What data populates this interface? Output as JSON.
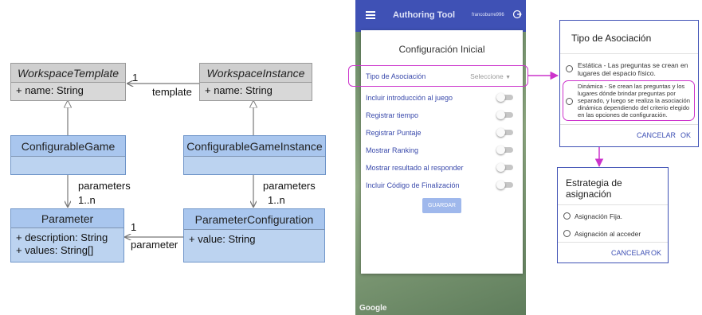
{
  "uml": {
    "workspace_template": {
      "name": "WorkspaceTemplate",
      "attr": "+ name: String"
    },
    "workspace_instance": {
      "name": "WorkspaceInstance",
      "attr": "+ name: String"
    },
    "configurable_game": {
      "name": "ConfigurableGame"
    },
    "configurable_game_instance": {
      "name": "ConfigurableGameInstance"
    },
    "parameter": {
      "name": "Parameter",
      "attr1": "+ description: String",
      "attr2": "+ values: String[]"
    },
    "parameter_configuration": {
      "name": "ParameterConfiguration",
      "attr": "+ value: String"
    },
    "labels": {
      "template": "template",
      "template_mult": "1",
      "parameters_left": "parameters",
      "mult_left": "1..n",
      "parameters_right": "parameters",
      "mult_right": "1..n",
      "parameter": "parameter",
      "parameter_mult": "1"
    }
  },
  "phone": {
    "app_title": "Authoring Tool",
    "user": "francoburre996",
    "dialog_title": "Configuración Inicial",
    "tipo_label": "Tipo de Asociación",
    "tipo_value": "Seleccione",
    "options": [
      "Incluir introducción al juego",
      "Registrar tiempo",
      "Registrar Puntaje",
      "Mostrar Ranking",
      "Mostrar resultado al responder",
      "Incluir Código de Finalización"
    ],
    "save_button": "GUARDAR",
    "map_watermark": "Google"
  },
  "tipo_dialog": {
    "title": "Tipo de Asociación",
    "option1": "Estática - Las preguntas se crean en lugares del espacio físico.",
    "option2": "Dinámica - Se crean las preguntas y los lugares dónde brindar preguntas por separado, y luego se realiza la asociación dinámica dependiendo del criterio elegido en las opciones de configuración.",
    "cancel": "CANCELAR",
    "ok": "OK"
  },
  "estrategia_dialog": {
    "title": "Estrategia de asignación",
    "option1": "Asignación Fija.",
    "option2": "Asignación al acceder",
    "cancel": "CANCELAR",
    "ok": "OK"
  },
  "colors": {
    "uml_gray": "#d8d8d8",
    "uml_blue": "#bcd3f0",
    "app_bar": "#3f51b5",
    "highlight": "#cc33cc",
    "link_text": "#3949ab"
  }
}
